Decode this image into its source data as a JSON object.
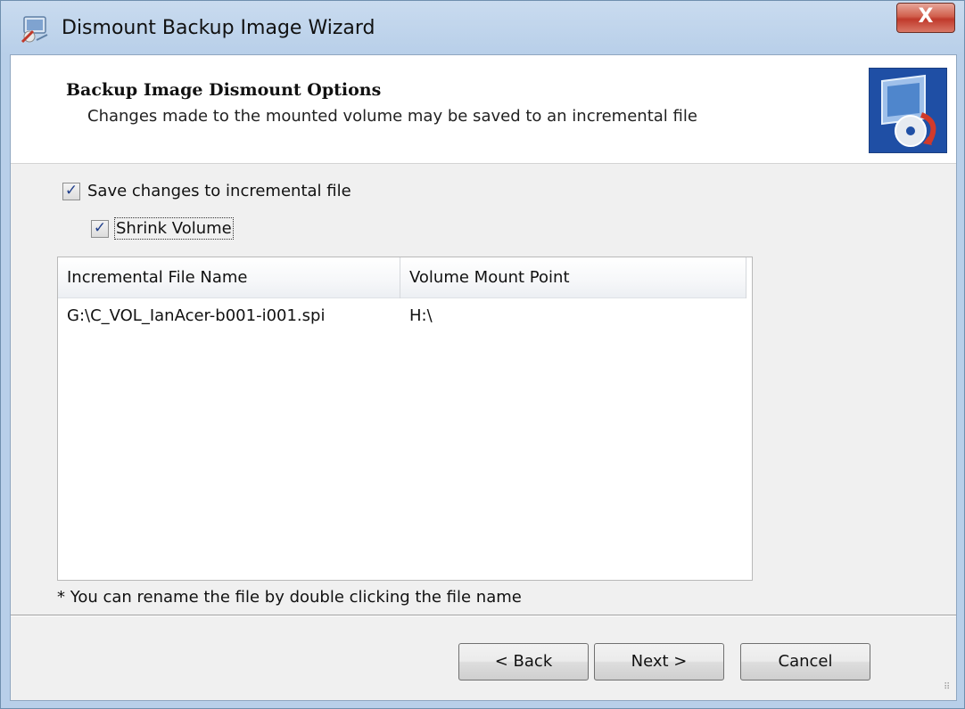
{
  "window": {
    "title": "Dismount Backup Image Wizard",
    "close_label": "X"
  },
  "header": {
    "title": "Backup Image Dismount Options",
    "subtitle": "Changes made to the mounted volume may be saved to an incremental file"
  },
  "options": {
    "save_changes": {
      "label": "Save changes to incremental file",
      "checked": true
    },
    "shrink_volume": {
      "label": "Shrink Volume",
      "checked": true
    }
  },
  "table": {
    "columns": [
      "Incremental File Name",
      "Volume Mount Point"
    ],
    "rows": [
      [
        "G:\\C_VOL_IanAcer-b001-i001.spi",
        "H:\\"
      ]
    ]
  },
  "note": "* You can rename the file by double clicking the file name",
  "buttons": {
    "back": "< Back",
    "next": "Next >",
    "cancel": "Cancel"
  },
  "colors": {
    "title_bar": "#b8cfe9",
    "client_bg": "#f0f0f0",
    "close_red": "#c0392b",
    "logo_blue": "#1f4fa5"
  },
  "icons": {
    "app": "wizard-app-icon",
    "logo": "backup-monitor-logo",
    "close": "close-icon"
  }
}
